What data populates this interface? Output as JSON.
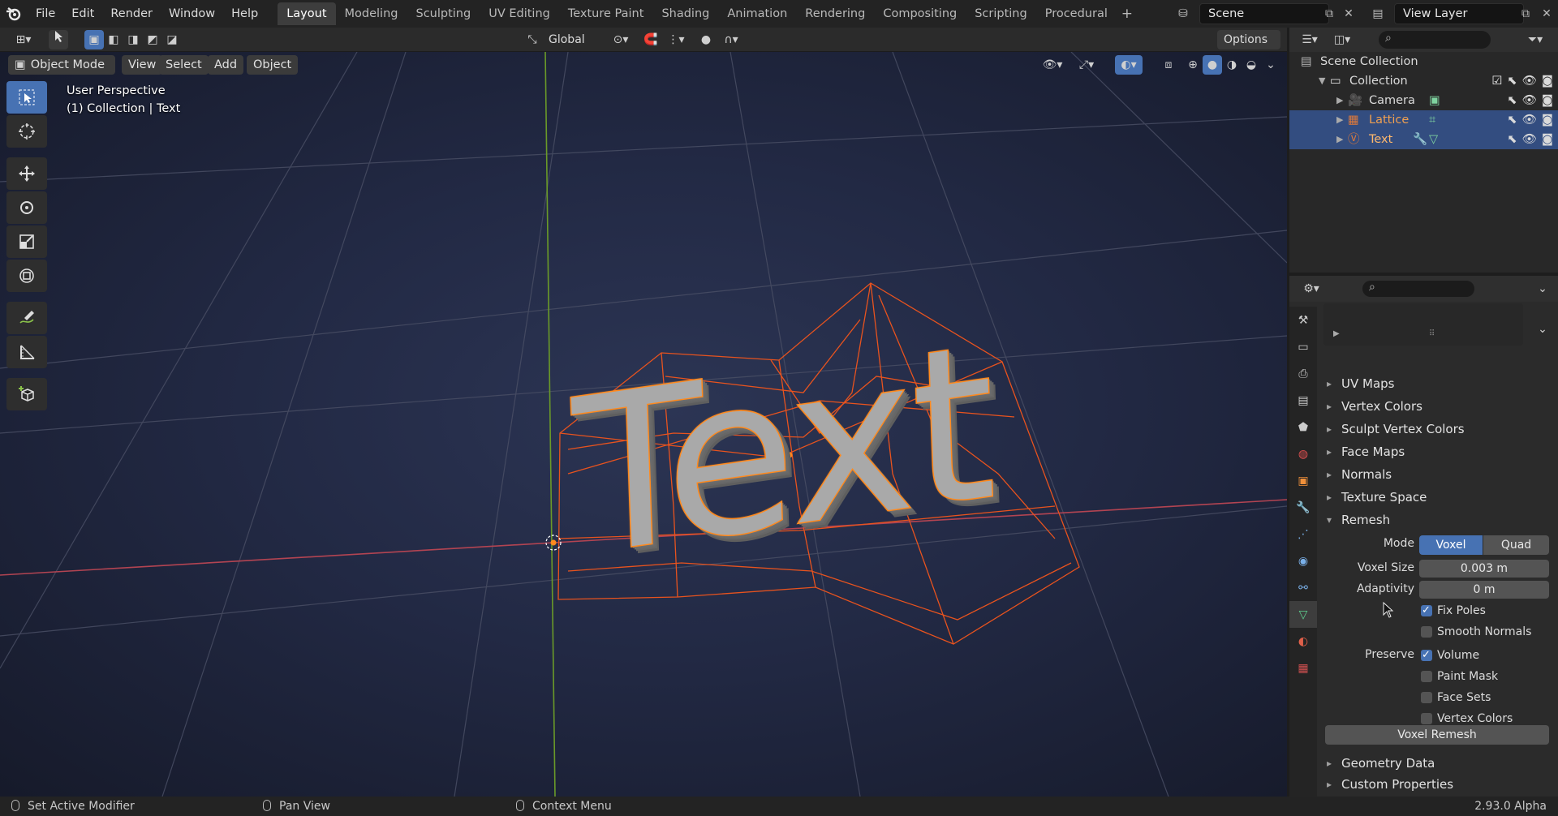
{
  "menu": {
    "file": "File",
    "edit": "Edit",
    "render": "Render",
    "window": "Window",
    "help": "Help"
  },
  "workspaces": [
    "Layout",
    "Modeling",
    "Sculpting",
    "UV Editing",
    "Texture Paint",
    "Shading",
    "Animation",
    "Rendering",
    "Compositing",
    "Scripting",
    "Procedural"
  ],
  "add_workspace": "+",
  "scene": {
    "name": "Scene",
    "view_layer": "View Layer"
  },
  "header": {
    "transform_orientation": "Global",
    "options": "Options"
  },
  "viewport": {
    "mode": "Object Mode",
    "menus": {
      "view": "View",
      "select": "Select",
      "add": "Add",
      "object": "Object"
    },
    "perspective": "User Perspective",
    "context": "(1) Collection | Text",
    "text_object": "Text"
  },
  "outliner": {
    "root": "Scene Collection",
    "collection": "Collection",
    "items": [
      "Camera",
      "Lattice",
      "Text"
    ]
  },
  "properties": {
    "panels_top": [
      "UV Maps",
      "Vertex Colors",
      "Sculpt Vertex Colors",
      "Face Maps",
      "Normals",
      "Texture Space"
    ],
    "remesh": {
      "title": "Remesh",
      "mode_label": "Mode",
      "mode_voxel": "Voxel",
      "mode_quad": "Quad",
      "voxel_size_label": "Voxel Size",
      "voxel_size": "0.003 m",
      "adaptivity_label": "Adaptivity",
      "adaptivity": "0 m",
      "fix_poles": "Fix Poles",
      "smooth_normals": "Smooth Normals",
      "preserve_label": "Preserve",
      "volume": "Volume",
      "paint_mask": "Paint Mask",
      "face_sets": "Face Sets",
      "vertex_colors": "Vertex Colors",
      "voxel_remesh_button": "Voxel Remesh"
    },
    "panels_bottom": [
      "Geometry Data",
      "Custom Properties"
    ]
  },
  "status": {
    "left": "Set Active Modifier",
    "middle": "Pan View",
    "right": "Context Menu",
    "version": "2.93.0 Alpha"
  },
  "colors": {
    "accent": "#4772b3",
    "selection_outline": "#ff8a1e",
    "lattice": "#e8531e",
    "x_axis": "#c4424f",
    "y_axis": "#6a9a28"
  }
}
